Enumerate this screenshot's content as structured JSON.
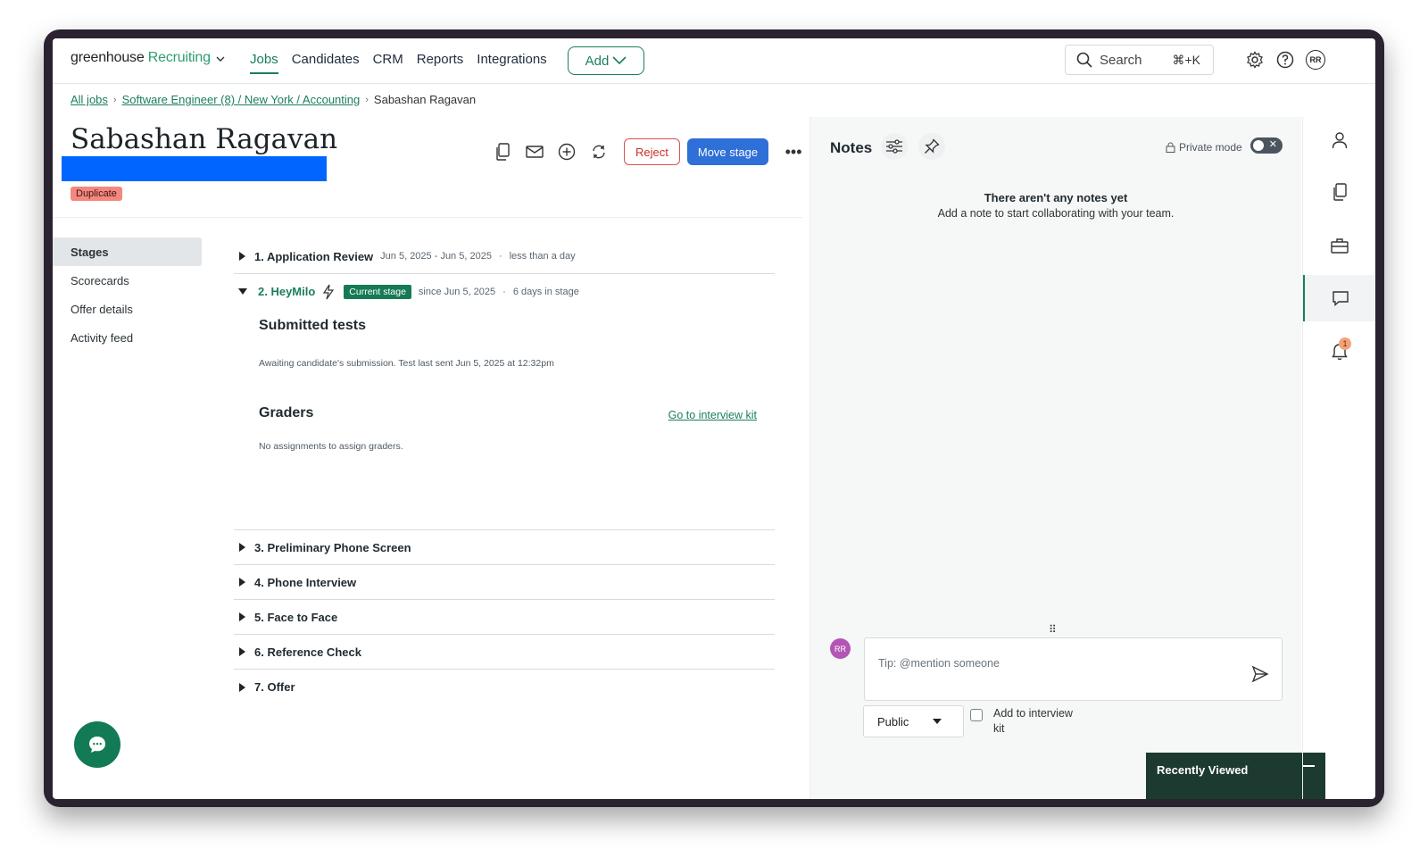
{
  "app": {
    "logo_main": "greenhouse",
    "logo_sub": "Recruiting"
  },
  "nav": {
    "items": [
      {
        "label": "Jobs",
        "active": true
      },
      {
        "label": "Candidates"
      },
      {
        "label": "CRM"
      },
      {
        "label": "Reports"
      },
      {
        "label": "Integrations"
      }
    ],
    "add_label": "Add",
    "search_placeholder": "Search",
    "search_shortcut": "⌘+K",
    "user_initials": "RR"
  },
  "breadcrumb": {
    "all_jobs": "All jobs",
    "job": "Software Engineer (8) / New York / Accounting",
    "current": "Sabashan Ragavan"
  },
  "candidate": {
    "name": "Sabashan Ragavan",
    "badge": "Duplicate"
  },
  "actions": {
    "reject": "Reject",
    "move_stage": "Move stage"
  },
  "subnav": {
    "items": [
      "Stages",
      "Scorecards",
      "Offer details",
      "Activity feed"
    ],
    "active": "Stages"
  },
  "stages": {
    "s1": {
      "name": "1. Application Review",
      "dates": "Jun 5, 2025 - Jun 5, 2025",
      "dot": "·",
      "duration": "less than a day"
    },
    "s2": {
      "name": "2. HeyMilo",
      "badge": "Current stage",
      "since": "since Jun 5, 2025",
      "dot": "·",
      "duration": "6 days in stage"
    },
    "submitted_title": "Submitted tests",
    "submitted_text": "Awaiting candidate's submission. Test last sent Jun 5, 2025 at 12:32pm",
    "graders_title": "Graders",
    "graders_link": "Go to interview kit",
    "graders_text": "No assignments to assign graders.",
    "rest": [
      "3. Preliminary Phone Screen",
      "4. Phone Interview",
      "5. Face to Face",
      "6. Reference Check",
      "7. Offer"
    ]
  },
  "notes": {
    "title": "Notes",
    "private_mode": "Private mode",
    "empty_title": "There aren't any notes yet",
    "empty_sub": "Add a note to start collaborating with your team.",
    "drag_handle": "⠿",
    "avatar": "RR",
    "input_placeholder": "Tip: @mention someone",
    "visibility": "Public",
    "add_to_kit": "Add to interview kit",
    "recently_viewed": "Recently Viewed"
  },
  "rail": {
    "notification_count": "1"
  },
  "colors": {
    "brand_green": "#1a7f5a",
    "primary_blue": "#2f6fd8",
    "reject_red": "#d9534f",
    "redaction": "#0066ff"
  }
}
